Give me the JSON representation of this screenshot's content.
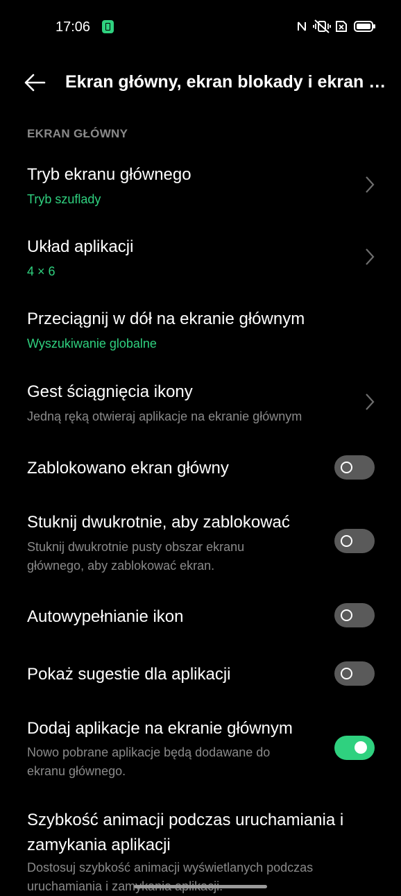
{
  "status_bar": {
    "time": "17:06",
    "icons": [
      "battery-saver-icon",
      "nfc-icon",
      "vibrate-off-icon",
      "sim-off-icon",
      "battery-icon"
    ]
  },
  "header": {
    "back_icon": "back-arrow-icon",
    "title": "Ekran główny, ekran blokady i ekran za..."
  },
  "section": {
    "title": "EKRAN GŁÓWNY"
  },
  "items": [
    {
      "title": "Tryb ekranu głównego",
      "subtitle": "Tryb szuflady",
      "control": "chevron"
    },
    {
      "title": "Układ aplikacji",
      "subtitle": "4 × 6",
      "control": "chevron"
    },
    {
      "title": "Przeciągnij w dół na ekranie głównym",
      "subtitle": "Wyszukiwanie globalne",
      "control": "none"
    },
    {
      "title": "Gest ściągnięcia ikony",
      "subtitle": "Jedną ręką otwieraj aplikacje na ekranie głównym",
      "control": "chevron"
    },
    {
      "title": "Zablokowano ekran główny",
      "subtitle": "",
      "control": "toggle",
      "on": false
    },
    {
      "title": "Stuknij dwukrotnie, aby zablokować",
      "subtitle": "Stuknij dwukrotnie pusty obszar ekranu głównego, aby zablokować ekran.",
      "control": "toggle",
      "on": false
    },
    {
      "title": "Autowypełnianie ikon",
      "subtitle": "",
      "control": "toggle",
      "on": false
    },
    {
      "title": "Pokaż sugestie dla aplikacji",
      "subtitle": "",
      "control": "toggle",
      "on": false
    },
    {
      "title": "Dodaj aplikacje na ekranie głównym",
      "subtitle": "Nowo pobrane aplikacje będą dodawane do ekranu głównego.",
      "control": "toggle",
      "on": true
    },
    {
      "title": "Szybkość animacji podczas uruchamiania i zamykania aplikacji",
      "subtitle": "Dostosuj szybkość animacji wyświetlanych podczas uruchamiania i zamykania aplikacji.",
      "control": "none"
    }
  ],
  "colors": {
    "accent": "#2fd17f",
    "background": "#000000",
    "secondary_text": "#8a8a8a",
    "toggle_off": "#5a5a5a"
  }
}
